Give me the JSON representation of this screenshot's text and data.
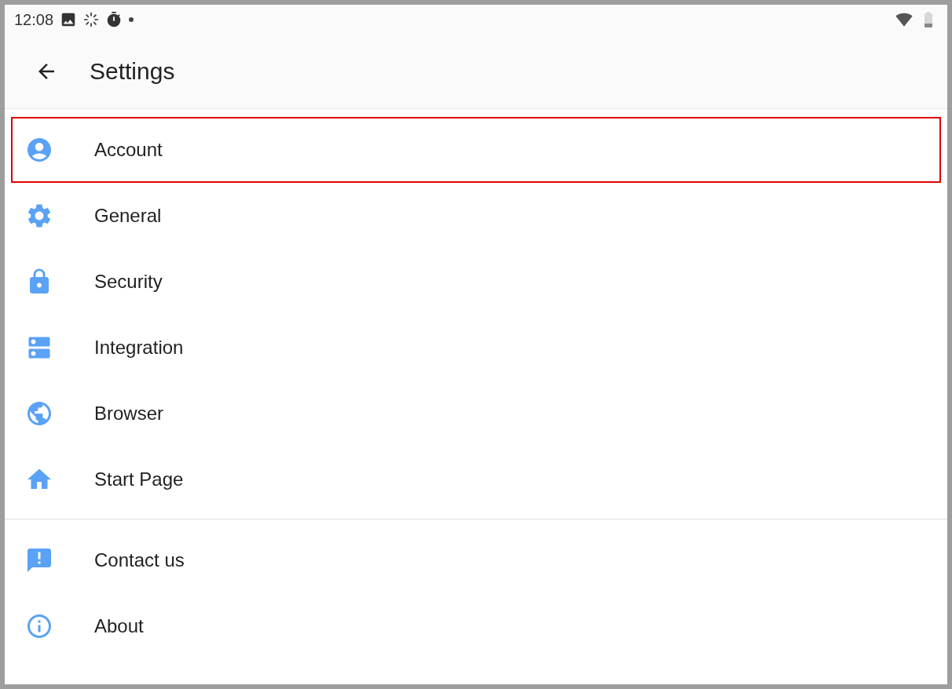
{
  "status_bar": {
    "time": "12:08"
  },
  "app_bar": {
    "title": "Settings"
  },
  "groups": [
    {
      "items": [
        {
          "label": "Account",
          "selected": true
        },
        {
          "label": "General",
          "selected": false
        },
        {
          "label": "Security",
          "selected": false
        },
        {
          "label": "Integration",
          "selected": false
        },
        {
          "label": "Browser",
          "selected": false
        },
        {
          "label": "Start Page",
          "selected": false
        }
      ]
    },
    {
      "items": [
        {
          "label": "Contact us",
          "selected": false
        },
        {
          "label": "About",
          "selected": false
        }
      ]
    }
  ]
}
